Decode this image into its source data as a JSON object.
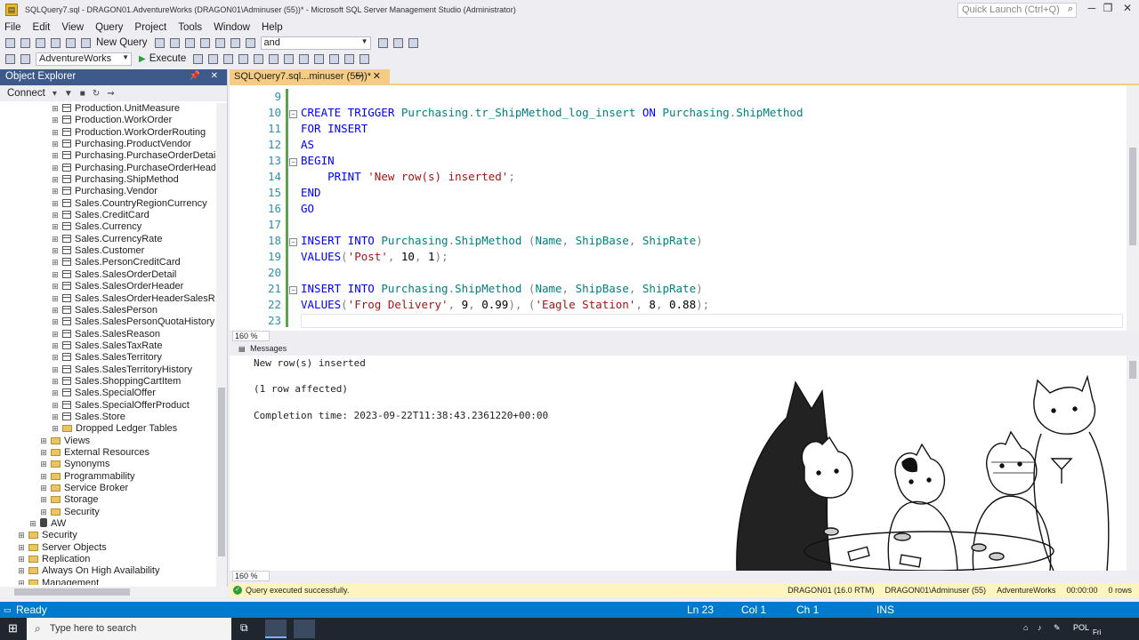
{
  "window": {
    "title": "SQLQuery7.sql - DRAGON01.AdventureWorks (DRAGON01\\Adminuser (55))* - Microsoft SQL Server Management Studio (Administrator)",
    "quick_launch": "Quick Launch (Ctrl+Q)"
  },
  "menu": [
    "File",
    "Edit",
    "View",
    "Query",
    "Project",
    "Tools",
    "Window",
    "Help"
  ],
  "toolbar": {
    "new_query": "New Query",
    "find_value": "and",
    "database": "AdventureWorks",
    "execute": "Execute"
  },
  "object_explorer": {
    "title": "Object Explorer",
    "connect": "Connect",
    "tables": [
      "Production.UnitMeasure",
      "Production.WorkOrder",
      "Production.WorkOrderRouting",
      "Purchasing.ProductVendor",
      "Purchasing.PurchaseOrderDetail",
      "Purchasing.PurchaseOrderHeader",
      "Purchasing.ShipMethod",
      "Purchasing.Vendor",
      "Sales.CountryRegionCurrency",
      "Sales.CreditCard",
      "Sales.Currency",
      "Sales.CurrencyRate",
      "Sales.Customer",
      "Sales.PersonCreditCard",
      "Sales.SalesOrderDetail",
      "Sales.SalesOrderHeader",
      "Sales.SalesOrderHeaderSalesRe",
      "Sales.SalesPerson",
      "Sales.SalesPersonQuotaHistory",
      "Sales.SalesReason",
      "Sales.SalesTaxRate",
      "Sales.SalesTerritory",
      "Sales.SalesTerritoryHistory",
      "Sales.ShoppingCartItem",
      "Sales.SpecialOffer",
      "Sales.SpecialOfferProduct",
      "Sales.Store"
    ],
    "dropped_ledger": "Dropped Ledger Tables",
    "db_folders": [
      "Views",
      "External Resources",
      "Synonyms",
      "Programmability",
      "Service Broker",
      "Storage",
      "Security"
    ],
    "aw_db": "AW",
    "server_folders": [
      "Security",
      "Server Objects",
      "Replication",
      "Always On High Availability",
      "Management"
    ]
  },
  "editor": {
    "tab_title": "SQLQuery7.sql...minuser (55))*",
    "line_numbers": [
      "9",
      "10",
      "11",
      "12",
      "13",
      "14",
      "15",
      "16",
      "17",
      "18",
      "19",
      "20",
      "21",
      "22",
      "23"
    ],
    "zoom": "160 %"
  },
  "results": {
    "tab": "Messages",
    "lines": [
      "New row(s) inserted",
      "(1 row affected)",
      "Completion time: 2023-09-22T11:38:43.2361220+00:00"
    ],
    "zoom": "160 %"
  },
  "query_status": {
    "message": "Query executed successfully.",
    "server": "DRAGON01 (16.0 RTM)",
    "user": "DRAGON01\\Adminuser (55)",
    "database": "AdventureWorks",
    "time": "00:00:00",
    "rows": "0 rows"
  },
  "status_bar": {
    "state": "Ready",
    "line": "Ln 23",
    "col": "Col 1",
    "ch": "Ch 1",
    "mode": "INS"
  },
  "taskbar": {
    "search_placeholder": "Type here to search",
    "lang": "POL",
    "day": "Fri"
  },
  "colors": {
    "oe_header": "#3e5a8a",
    "tab_active": "#f5cc84",
    "status_bar": "#007acc",
    "keyword": "#0000ff",
    "string": "#a31515",
    "line_number": "#2b91af"
  }
}
